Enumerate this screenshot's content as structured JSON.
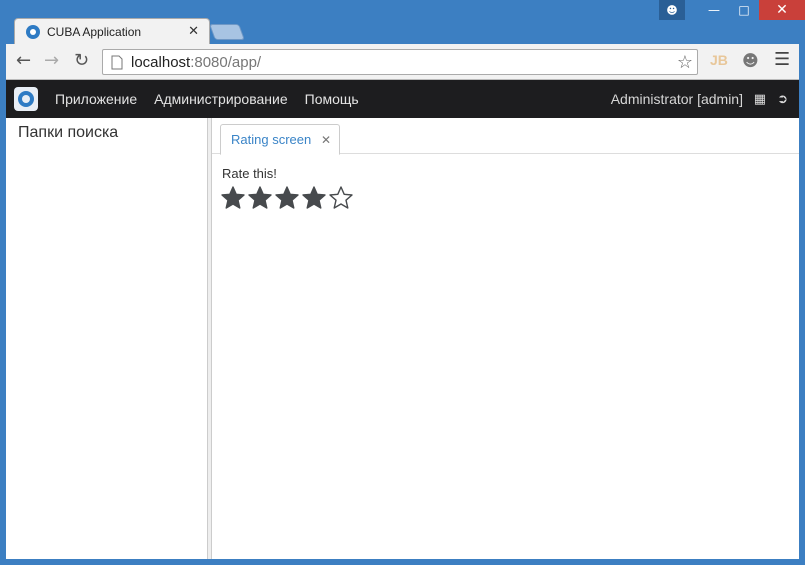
{
  "browser": {
    "tab_title": "CUBA Application",
    "url_host": "localhost",
    "url_path": ":8080/app/",
    "extension_jb": "JB"
  },
  "app": {
    "menu": [
      "Приложение",
      "Администрирование",
      "Помощь"
    ],
    "user": "Administrator [admin]",
    "sidebar_title": "Папки поиска",
    "tab_label": "Rating screen"
  },
  "rating": {
    "label": "Rate this!",
    "value": 4,
    "max": 5,
    "color": "#474a4d"
  },
  "colors": {
    "window": "#3c7fc2",
    "appbar": "#1d1d1f",
    "accent": "#3a84c7",
    "close": "#c9403a"
  },
  "icons": {
    "back": "arrow-left-icon",
    "forward": "arrow-right-icon",
    "reload": "reload-icon",
    "bookmark": "star-outline-icon",
    "menu": "hamburger-icon"
  }
}
